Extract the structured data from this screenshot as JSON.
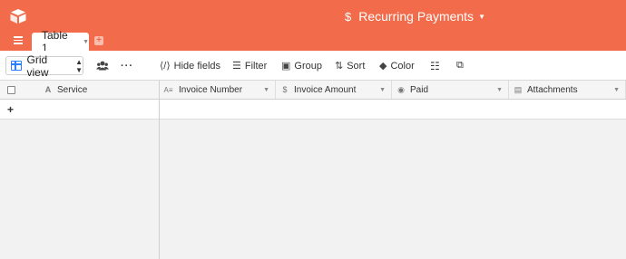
{
  "header": {
    "base_title": "Recurring Payments",
    "base_icon": "dollar-icon",
    "accent_color": "#f26b4a"
  },
  "tabs": [
    {
      "label": "Table 1"
    }
  ],
  "toolbar": {
    "view_label": "Grid view",
    "hide_fields": "Hide fields",
    "filter": "Filter",
    "group": "Group",
    "sort": "Sort",
    "color": "Color"
  },
  "table": {
    "primary_column": {
      "label": "Service",
      "icon": "text-type-icon"
    },
    "columns": [
      {
        "label": "Invoice Number",
        "icon": "long-text-icon"
      },
      {
        "label": "Invoice Amount",
        "icon": "currency-icon"
      },
      {
        "label": "Paid",
        "icon": "single-select-icon"
      },
      {
        "label": "Attachments",
        "icon": "attachment-icon"
      }
    ],
    "rows": []
  }
}
